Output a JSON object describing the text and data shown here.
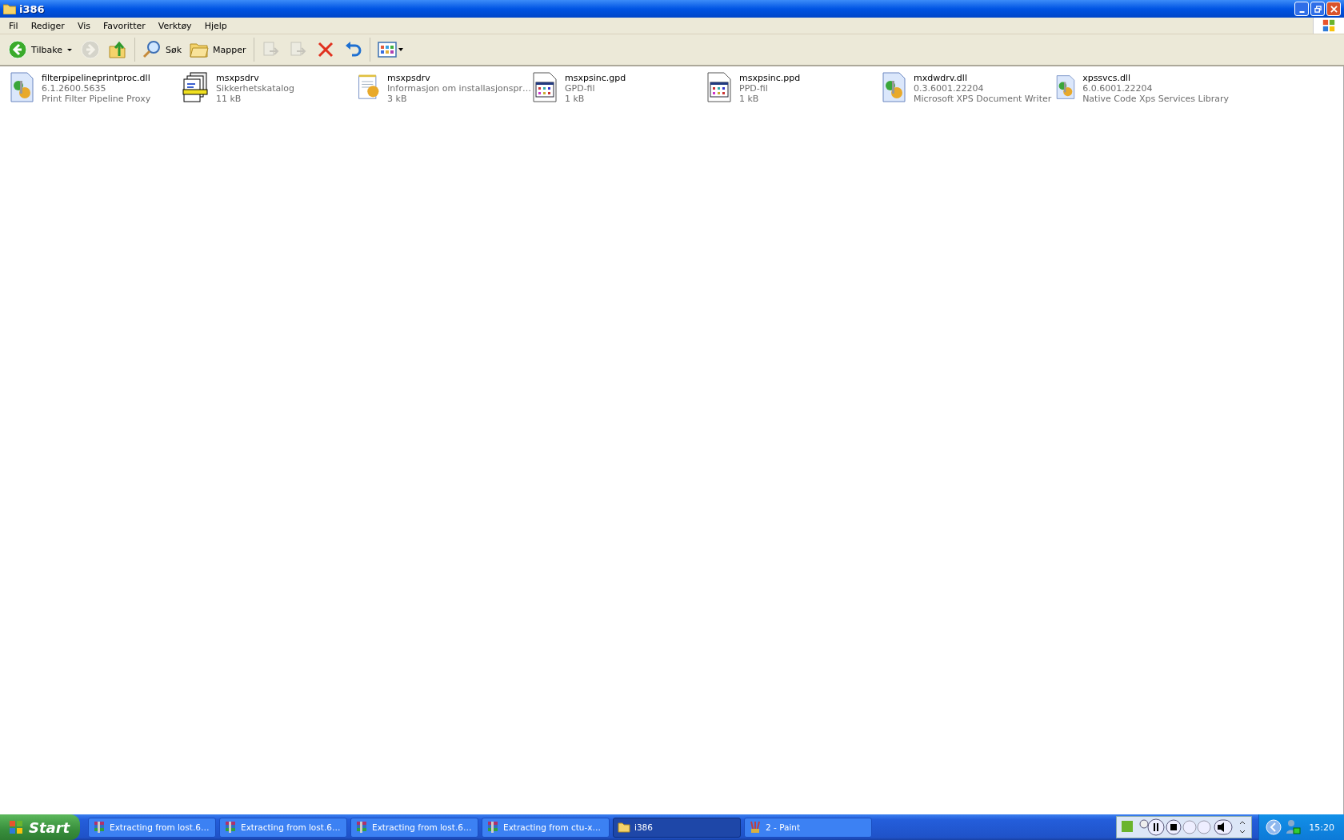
{
  "window": {
    "title": "i386"
  },
  "menu": [
    "Fil",
    "Rediger",
    "Vis",
    "Favoritter",
    "Verktøy",
    "Hjelp"
  ],
  "toolbar": [
    {
      "kind": "back",
      "label": "Tilbake",
      "disabled": false
    },
    {
      "kind": "forward",
      "disabled": true
    },
    {
      "kind": "up",
      "disabled": false
    },
    {
      "kind": "sep"
    },
    {
      "kind": "search",
      "label": "Søk",
      "disabled": false
    },
    {
      "kind": "folders",
      "label": "Mapper",
      "disabled": false
    },
    {
      "kind": "sep"
    },
    {
      "kind": "moveto",
      "disabled": true
    },
    {
      "kind": "copyto",
      "disabled": true
    },
    {
      "kind": "delete",
      "disabled": false
    },
    {
      "kind": "undo",
      "disabled": false
    },
    {
      "kind": "sep"
    },
    {
      "kind": "views",
      "disabled": false
    }
  ],
  "files": [
    {
      "kind": "dll",
      "name": "filterpipelineprintproc.dll",
      "line_2": "6.1.2600.5635",
      "line_3": "Print Filter Pipeline Proxy"
    },
    {
      "kind": "catalog",
      "name": "msxpsdrv",
      "line_2": "Sikkerhetskatalog",
      "line_3": "11 kB"
    },
    {
      "kind": "inf",
      "name": "msxpsdrv",
      "line_2": "Informasjon om installasjonspr…",
      "line_3": "3 kB"
    },
    {
      "kind": "ppd",
      "name": "msxpsinc.gpd",
      "line_2": "GPD-fil",
      "line_3": "1 kB"
    },
    {
      "kind": "ppd",
      "name": "msxpsinc.ppd",
      "line_2": "PPD-fil",
      "line_3": "1 kB"
    },
    {
      "kind": "dll",
      "name": "mxdwdrv.dll",
      "line_2": "0.3.6001.22204",
      "line_3": "Microsoft XPS Document Writer"
    },
    {
      "kind": "dll",
      "name": "xpssvcs.dll",
      "line_2": "6.0.6001.22204",
      "line_3": "Native Code Xps Services Library"
    }
  ],
  "taskbar": {
    "start": "Start",
    "tasks": [
      {
        "kind": "archive",
        "label": "Extracting from lost.6…",
        "selected": false
      },
      {
        "kind": "archive",
        "label": "Extracting from lost.6…",
        "selected": false
      },
      {
        "kind": "archive",
        "label": "Extracting from lost.6…",
        "selected": false
      },
      {
        "kind": "archive",
        "label": "Extracting from ctu-x…",
        "selected": false
      },
      {
        "kind": "folder",
        "label": "i386",
        "selected": true
      },
      {
        "kind": "paint",
        "label": "2 - Paint",
        "selected": false
      }
    ],
    "clock": "15:20"
  }
}
